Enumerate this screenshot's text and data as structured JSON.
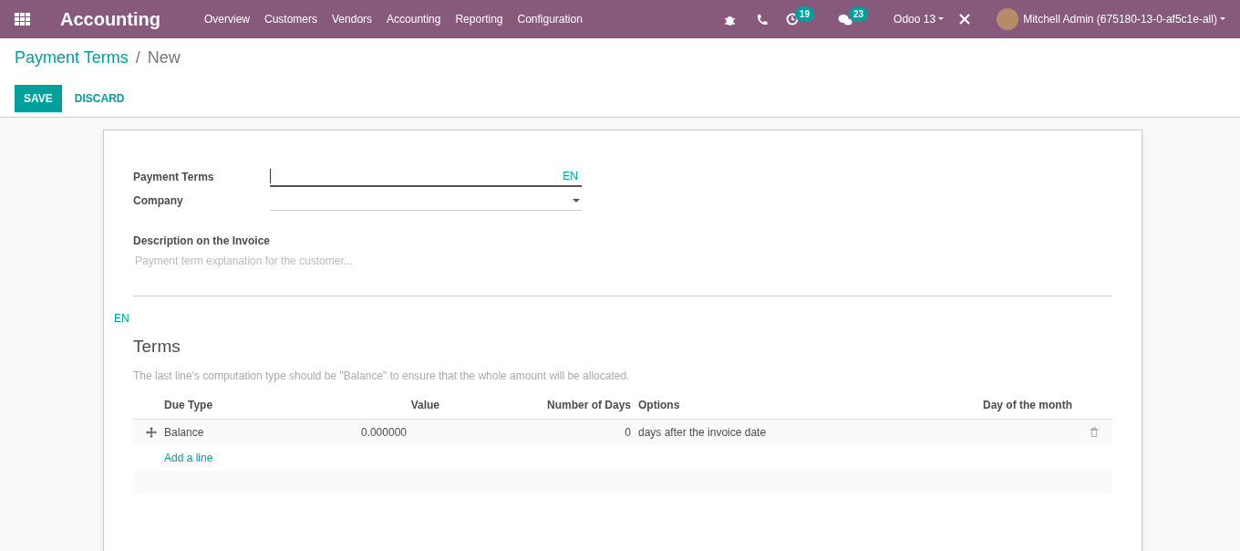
{
  "app_name": "Accounting",
  "menu": [
    "Overview",
    "Customers",
    "Vendors",
    "Accounting",
    "Reporting",
    "Configuration"
  ],
  "systray": {
    "activity_count": "19",
    "message_count": "23",
    "database": "Odoo 13",
    "user": "Mitchell Admin (675180-13-0-af5c1e-all)"
  },
  "breadcrumb": [
    "Payment Terms",
    "New"
  ],
  "breadcrumb_separator": "/",
  "buttons": [
    "SAVE",
    "DISCARD"
  ],
  "fields": [
    {
      "label": "Payment Terms",
      "kind": "text",
      "lang": "EN"
    },
    {
      "label": "Company",
      "kind": "select"
    }
  ],
  "description": {
    "label": "Description on the Invoice",
    "placeholder": "Payment term explanation for the customer...",
    "lang": "EN"
  },
  "terms": {
    "title": "Terms",
    "help": "The last line's computation type should be \"Balance\" to ensure that the whole amount will be allocated.",
    "columns": [
      "Due Type",
      "Value",
      "Number of Days",
      "Options",
      "Day of the month"
    ],
    "rows": [
      [
        "Balance",
        "0.000000",
        "0",
        "days after the invoice date",
        ""
      ]
    ],
    "add_line": "Add a line"
  }
}
